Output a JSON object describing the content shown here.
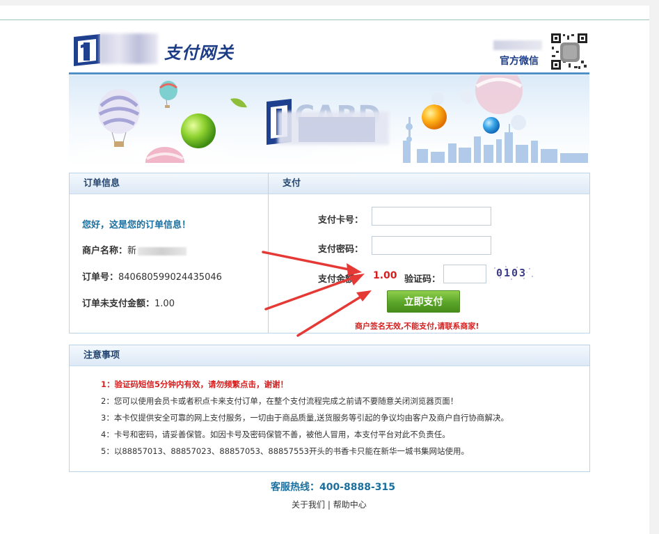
{
  "header": {
    "title": "支付网关",
    "wechat_label": "官方微信"
  },
  "order_panel": {
    "title": "订单信息",
    "greeting": "您好，这是您的订单信息！",
    "merchant_label": "商户名称：",
    "merchant_value": "新",
    "order_no_label": "订单号：",
    "order_no_value": "840680599024435046",
    "unpaid_label": "订单未支付金额：",
    "unpaid_value": "1.00"
  },
  "pay_panel": {
    "title": "支付",
    "card_label": "支付卡号：",
    "card_value": "",
    "password_label": "支付密码：",
    "password_value": "",
    "amount_label": "支付金额：",
    "amount_value": "1.00",
    "captcha_label": "验证码：",
    "captcha_value": "",
    "captcha_image_text": "0103",
    "pay_button": "立即支付",
    "error_message": "商户签名无效,不能支付,请联系商家!"
  },
  "notice": {
    "title": "注意事项",
    "items": [
      "1：验证码短信5分钟内有效，请勿频繁点击，谢谢！",
      "2：您可以使用会员卡或者积点卡来支付订单，在整个支付流程完成之前请不要随意关闭浏览器页面！",
      "3：本卡仅提供安全可靠的网上支付服务，一切由于商品质量,送货服务等引起的争议均由客户及商户自行协商解决。",
      "4：卡号和密码，请妥善保管。如因卡号及密码保管不善，被他人冒用，本支付平台对此不负责任。",
      "5：以88857013、88857023、88857053、88857553开头的书香卡只能在新华一城书集网站使用。"
    ]
  },
  "footer": {
    "hotline_label": "客服热线：",
    "hotline_number": "400-8888-315",
    "about_link": "关于我们",
    "separator": "|",
    "help_link": "帮助中心"
  },
  "colors": {
    "brand_blue": "#1d3c86",
    "link_blue": "#1b6f9e",
    "error_red": "#d81e1e",
    "button_green": "#5ba52a",
    "annotation_arrow": "#e53935"
  }
}
